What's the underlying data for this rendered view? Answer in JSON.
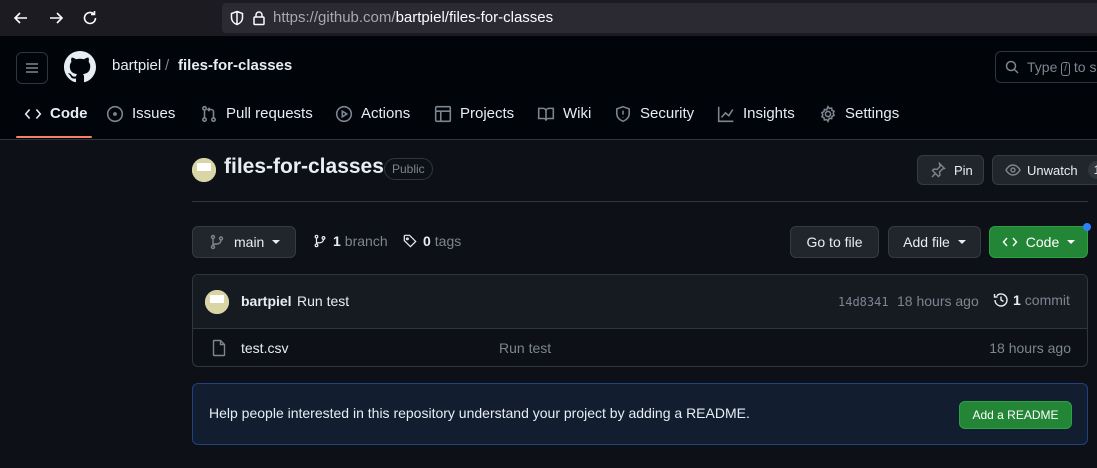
{
  "browser": {
    "url_host": "https://github.com/",
    "url_path": "bartpiel/files-for-classes"
  },
  "header": {
    "owner": "bartpiel",
    "separator": "/",
    "repo": "files-for-classes",
    "search_prefix": "Type",
    "search_key": "/",
    "search_suffix": "to s"
  },
  "tabs": [
    {
      "label": "Code",
      "icon": "code-icon"
    },
    {
      "label": "Issues",
      "icon": "issue-icon"
    },
    {
      "label": "Pull requests",
      "icon": "pull-request-icon"
    },
    {
      "label": "Actions",
      "icon": "play-icon"
    },
    {
      "label": "Projects",
      "icon": "table-icon"
    },
    {
      "label": "Wiki",
      "icon": "book-icon"
    },
    {
      "label": "Security",
      "icon": "shield-icon"
    },
    {
      "label": "Insights",
      "icon": "graph-icon"
    },
    {
      "label": "Settings",
      "icon": "gear-icon"
    }
  ],
  "repo": {
    "title": "files-for-classes",
    "visibility": "Public",
    "pin_label": "Pin",
    "watch_label": "Unwatch",
    "watch_count": "1"
  },
  "toolbar": {
    "branch": "main",
    "branch_count": "1",
    "branch_label": "branch",
    "tag_count": "0",
    "tag_label": "tags",
    "go_to_file": "Go to file",
    "add_file": "Add file",
    "code": "Code"
  },
  "latest_commit": {
    "author": "bartpiel",
    "message": "Run test",
    "sha": "14d8341",
    "time": "18 hours ago",
    "commit_count": "1",
    "commit_label": "commit"
  },
  "files": [
    {
      "name": "test.csv",
      "commit_message": "Run test",
      "time": "18 hours ago"
    }
  ],
  "readme_prompt": {
    "text": "Help people interested in this repository understand your project by adding a README.",
    "button": "Add a README"
  },
  "colors": {
    "accent_green": "#238636",
    "tab_underline": "#f78166",
    "notification_dot": "#2f81f7"
  }
}
